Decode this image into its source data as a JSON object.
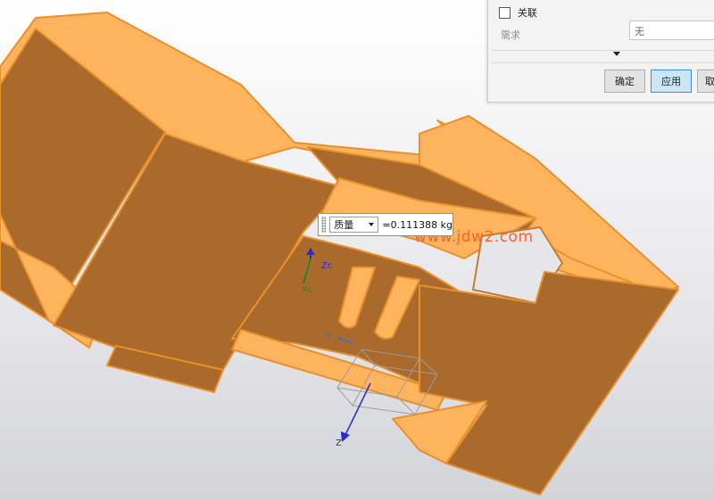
{
  "dialog": {
    "associate_label": "关联",
    "associate_checked": false,
    "requirement_label": "需求",
    "requirement_value": "无",
    "ok_label": "确定",
    "apply_label": "应用",
    "cancel_label": "取"
  },
  "measure": {
    "type_selected": "质量",
    "value_text": "=0.111388 kg"
  },
  "watermark": "www.jdw2.com",
  "axes": {
    "zc_label": "Zc",
    "xc_label": "Xc",
    "y_label": "Y",
    "z_label": "Z"
  },
  "colors": {
    "part_face_light": "#fdb45c",
    "part_face_dark": "#a96a2c",
    "part_edge": "#e88e2e",
    "accent_button": "#cde6f7",
    "watermark": "#ff5f2a"
  }
}
